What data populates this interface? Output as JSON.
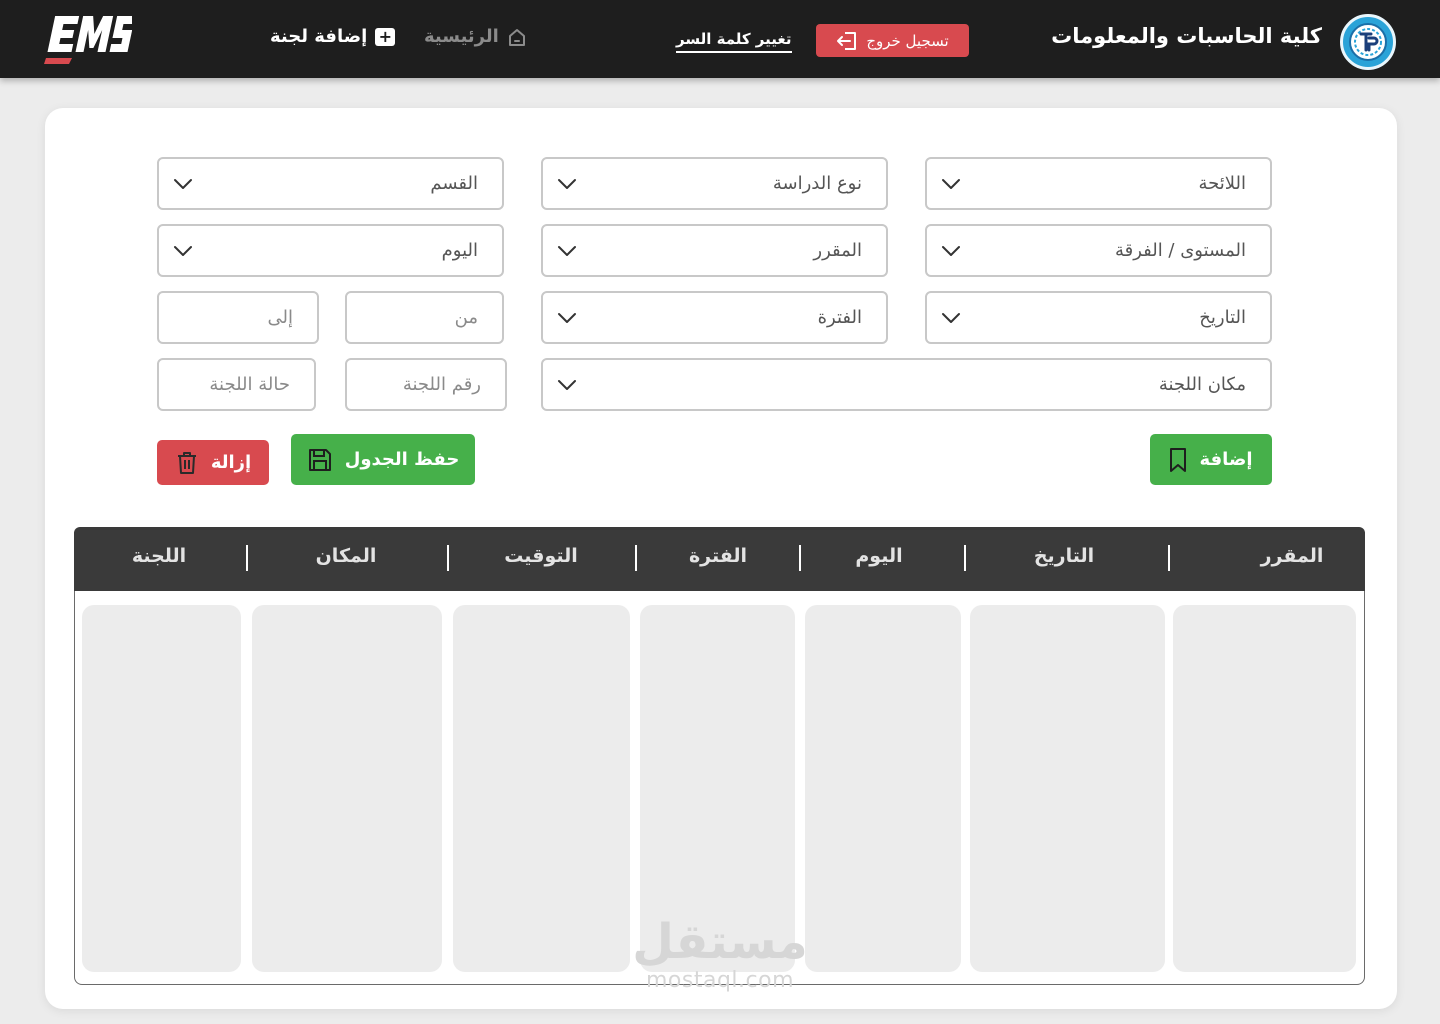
{
  "header": {
    "app_logo_text": "EMS",
    "brand_title": "كلية الحاسبات والمعلومات",
    "logout_label": "تسجيل خروج",
    "change_password_label": "تغيير كلمة السر",
    "nav_home_label": "الرئيسية",
    "nav_add_label": "إضافة لجنة",
    "colors": {
      "bar": "#1e1e1e",
      "logout": "#d84a4f",
      "home_inactive": "#8b8b8b"
    }
  },
  "filters": {
    "regulation": "اللائحة",
    "study_type": "نوع الدراسة",
    "department": "القسم",
    "level": "المستوى / الفرقة",
    "course": "المقرر",
    "day": "اليوم",
    "date": "التاريخ",
    "period": "الفترة",
    "from_placeholder": "من",
    "to_placeholder": "إلى",
    "location": "مكان اللجنة",
    "committee_number_placeholder": "رقم اللجنة",
    "committee_status_placeholder": "حالة اللجنة"
  },
  "actions": {
    "add_label": "إضافة",
    "save_label": "حفظ الجدول",
    "remove_label": "إزالة",
    "colors": {
      "green": "#46b04a",
      "red": "#d84a4f"
    }
  },
  "table": {
    "headers": {
      "course": "المقرر",
      "date": "التاريخ",
      "day": "اليوم",
      "period": "الفترة",
      "time": "التوقيت",
      "location": "المكان",
      "committee": "اللجنة"
    }
  },
  "watermark": {
    "ar": "مستقل",
    "en": "mostaql.com"
  }
}
